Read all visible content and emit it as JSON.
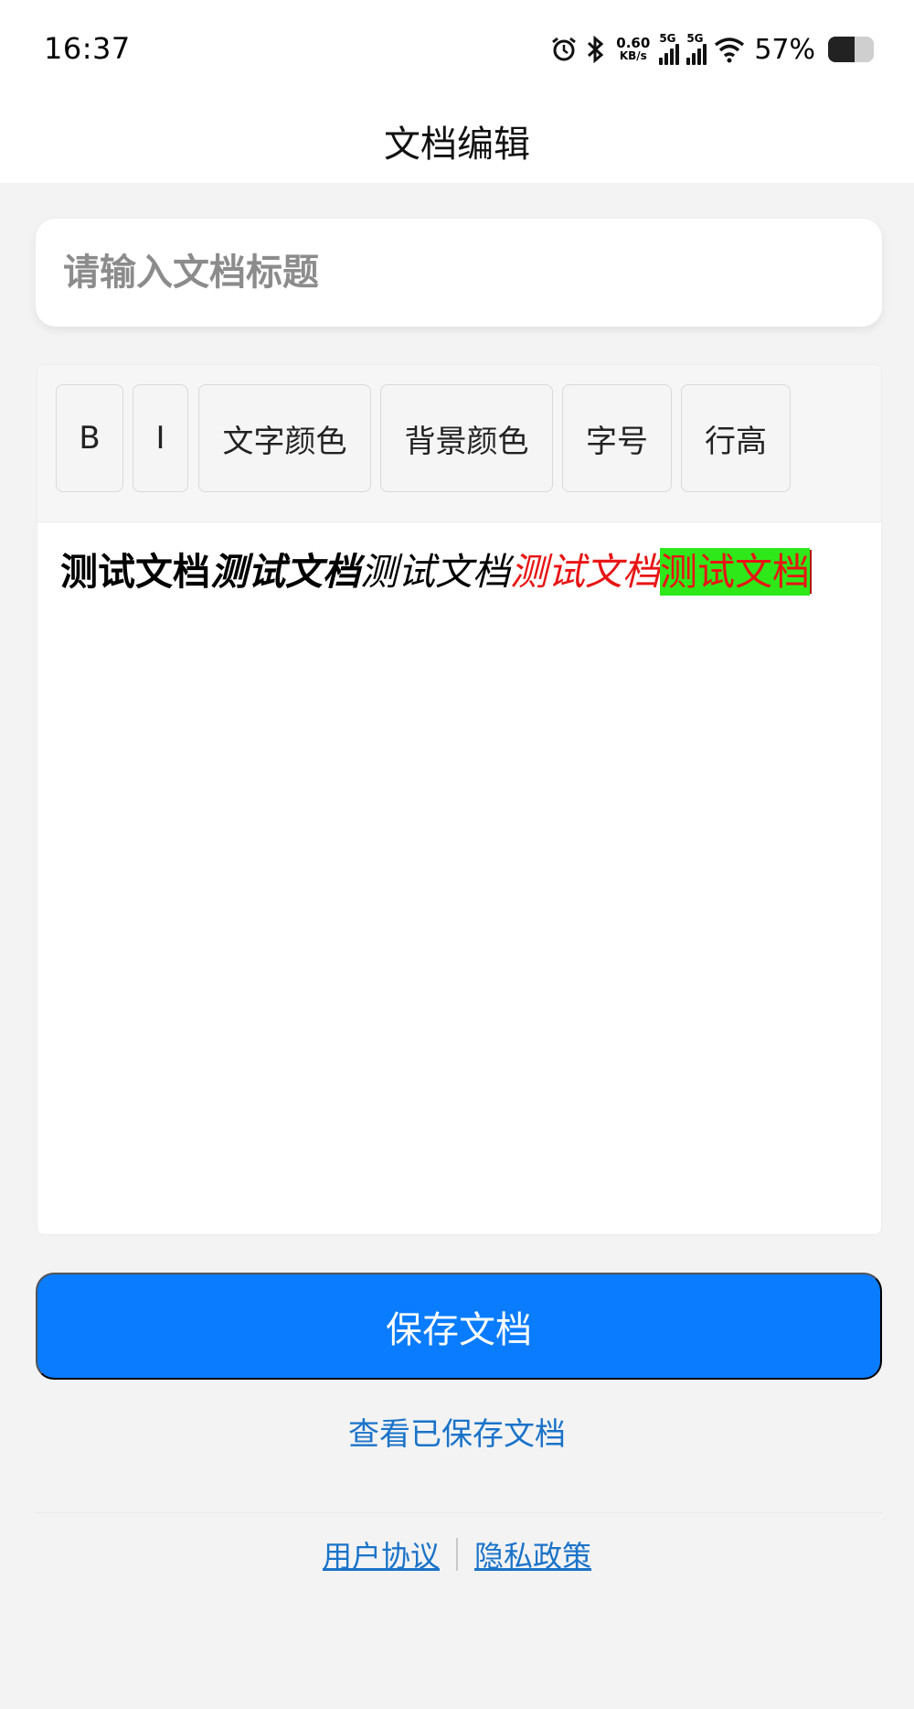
{
  "status_bar": {
    "time": "16:37",
    "net_speed_value": "0.60",
    "net_speed_unit": "KB/s",
    "signal1_label": "5G",
    "signal2_label": "5G",
    "battery_percent": "57%",
    "battery_level": 0.57
  },
  "header": {
    "title": "文档编辑"
  },
  "title_input": {
    "placeholder": "请输入文档标题",
    "value": ""
  },
  "toolbar": {
    "bold_label": "B",
    "italic_label": "I",
    "text_color_label": "文字颜色",
    "bg_color_label": "背景颜色",
    "font_size_label": "字号",
    "line_height_label": "行高"
  },
  "editor": {
    "segments": [
      {
        "text": "测试文档",
        "style": "bold"
      },
      {
        "text": "测试文档",
        "style": "bold-italic"
      },
      {
        "text": "测试文档",
        "style": "italic"
      },
      {
        "text": "测试文档",
        "style": "italic-red"
      },
      {
        "text": "测试文档",
        "style": "red-on-green"
      }
    ]
  },
  "actions": {
    "save_label": "保存文档",
    "view_saved_label": "查看已保存文档"
  },
  "footer": {
    "user_agreement": "用户协议",
    "privacy_policy": "隐私政策"
  },
  "colors": {
    "primary": "#0a7cff",
    "link": "#1a73c9",
    "red_text": "#e81414",
    "green_background": "#2ee81a"
  }
}
